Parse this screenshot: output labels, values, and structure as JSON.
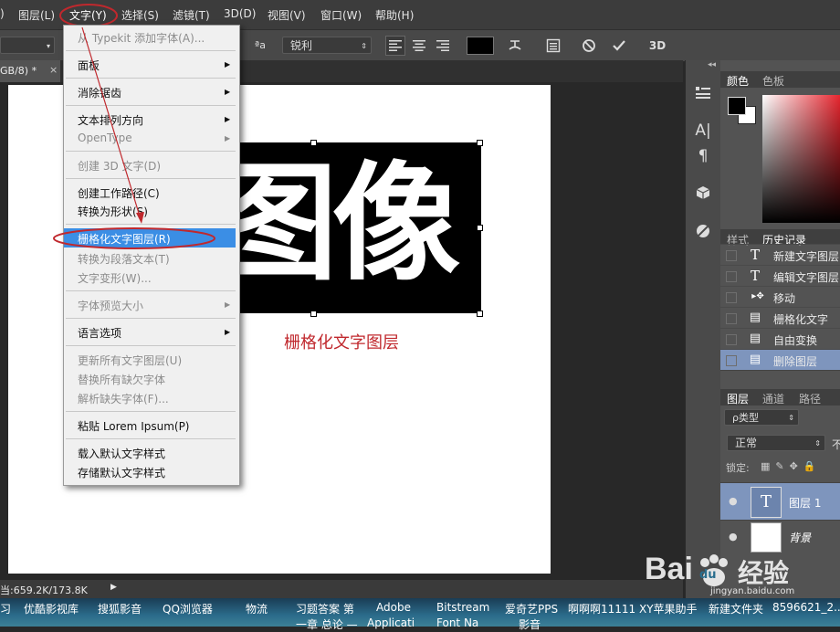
{
  "menubar": {
    "items": [
      ")",
      "图层(L)",
      "文字(Y)",
      "选择(S)",
      "滤镜(T)",
      "3D(D)",
      "视图(V)",
      "窗口(W)",
      "帮助(H)"
    ]
  },
  "options_bar": {
    "aa_glyph": "ªa",
    "aa_value": "锐利",
    "warp_icon": "warp-text-icon",
    "three_d_label": "3D"
  },
  "doc_tab": {
    "label": "GB/8) *",
    "close": "×"
  },
  "canvas": {
    "text_glyphs": "图像",
    "annotation": "栅格化文字图层",
    "annotation_color": "#c0282d"
  },
  "status": {
    "text": "当:659.2K/173.8K",
    "arrow": "▶"
  },
  "text_menu": {
    "items": [
      {
        "label": "从 Typekit 添加字体(A)...",
        "disabled": true,
        "submenu": false
      },
      {
        "label": "面板",
        "disabled": false,
        "submenu": true
      },
      {
        "label": "消除锯齿",
        "disabled": false,
        "submenu": true
      },
      {
        "label": "文本排列方向",
        "disabled": false,
        "submenu": true
      },
      {
        "label": "OpenType",
        "disabled": true,
        "submenu": true
      },
      {
        "label": "创建 3D 文字(D)",
        "disabled": true,
        "submenu": false
      },
      {
        "label": "创建工作路径(C)",
        "disabled": false,
        "submenu": false
      },
      {
        "label": "转换为形状(S)",
        "disabled": false,
        "submenu": false
      },
      {
        "label": "栅格化文字图层(R)",
        "disabled": false,
        "submenu": false,
        "highlighted": true
      },
      {
        "label": "转换为段落文本(T)",
        "disabled": true,
        "submenu": false
      },
      {
        "label": "文字变形(W)...",
        "disabled": true,
        "submenu": false
      },
      {
        "label": "字体预览大小",
        "disabled": true,
        "submenu": true
      },
      {
        "label": "语言选项",
        "disabled": false,
        "submenu": true
      },
      {
        "label": "更新所有文字图层(U)",
        "disabled": true,
        "submenu": false
      },
      {
        "label": "替换所有缺欠字体",
        "disabled": true,
        "submenu": false
      },
      {
        "label": "解析缺失字体(F)...",
        "disabled": true,
        "submenu": false
      },
      {
        "label": "粘贴 Lorem Ipsum(P)",
        "disabled": false,
        "submenu": false
      },
      {
        "label": "载入默认文字样式",
        "disabled": false,
        "submenu": false
      },
      {
        "label": "存储默认文字样式",
        "disabled": false,
        "submenu": false
      }
    ],
    "highlight_color": "#3b8ee5",
    "circle_color": "#c0282d"
  },
  "color_panel": {
    "tabs": [
      "颜色",
      "色板"
    ],
    "foreground": "#000000",
    "background": "#ffffff"
  },
  "history_panel": {
    "tabs": [
      "样式",
      "历史记录"
    ],
    "rows": [
      {
        "icon": "T",
        "label": "新建文字图层"
      },
      {
        "icon": "T",
        "label": "编辑文字图层"
      },
      {
        "icon": "▸✥",
        "label": "移动"
      },
      {
        "icon": "▤",
        "label": "栅格化文字"
      },
      {
        "icon": "▤",
        "label": "自由变换"
      },
      {
        "icon": "▤",
        "label": "删除图层"
      }
    ]
  },
  "layers_panel": {
    "tabs": [
      "图层",
      "通道",
      "路径"
    ],
    "filter": "ρ类型",
    "blend_mode": "正常",
    "opacity_cut": "不",
    "lock_label": "锁定:",
    "layers": [
      {
        "name": "图层 1",
        "thumb": "T"
      },
      {
        "name": "背景",
        "thumb": ""
      }
    ]
  },
  "taskbar": {
    "items": [
      {
        "line1": "习",
        "line2": ""
      },
      {
        "line1": "优酷影视库",
        "line2": ""
      },
      {
        "line1": "搜狐影音",
        "line2": ""
      },
      {
        "line1": "QQ浏览器",
        "line2": ""
      },
      {
        "line1": "物流",
        "line2": ""
      },
      {
        "line1": "习题答案 第",
        "line2": "一章 总论 —"
      },
      {
        "line1": "Adobe",
        "line2": "Applicati"
      },
      {
        "line1": "Bitstream",
        "line2": "Font Na"
      },
      {
        "line1": "爱奇艺PPS",
        "line2": "影音"
      },
      {
        "line1": "啊啊啊11111",
        "line2": ""
      },
      {
        "line1": "XY苹果助手",
        "line2": ""
      },
      {
        "line1": "新建文件夹",
        "line2": ""
      },
      {
        "line1": "8596621_2...",
        "line2": ""
      }
    ]
  },
  "watermark": {
    "brand": "Bai",
    "brand2": "du",
    "site_cn": "经验",
    "site": "jingyan.baidu.com"
  }
}
